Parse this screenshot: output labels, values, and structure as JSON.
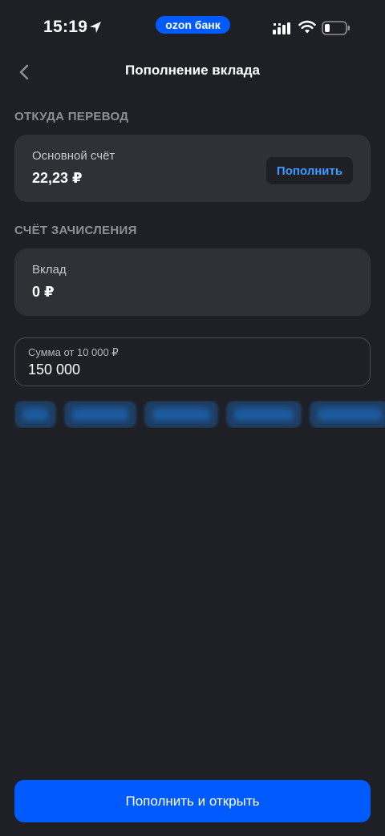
{
  "status_bar": {
    "time": "15:19",
    "brand": "ozon банк",
    "icons": [
      "location-arrow-icon",
      "signal-icon",
      "wifi-icon",
      "battery-icon"
    ]
  },
  "header": {
    "title": "Пополнение вклада",
    "back_icon": "chevron-left-icon"
  },
  "from_section": {
    "label": "ОТКУДА ПЕРЕВОД",
    "account_name": "Основной счёт",
    "balance": "22,23 ₽",
    "topup_label": "Пополнить"
  },
  "to_section": {
    "label": "СЧЁТ ЗАЧИСЛЕНИЯ",
    "account_name": "Вклад",
    "balance": "0 ₽"
  },
  "amount": {
    "hint": "Сумма от 10 000 ₽",
    "value": "150 000"
  },
  "quick_amounts_blurred": true,
  "footer": {
    "submit_label": "Пополнить и открыть"
  },
  "colors": {
    "background": "#1f2026",
    "card": "#303137",
    "accent": "#005bff",
    "link": "#3d9bff",
    "muted": "#8e8f97"
  }
}
